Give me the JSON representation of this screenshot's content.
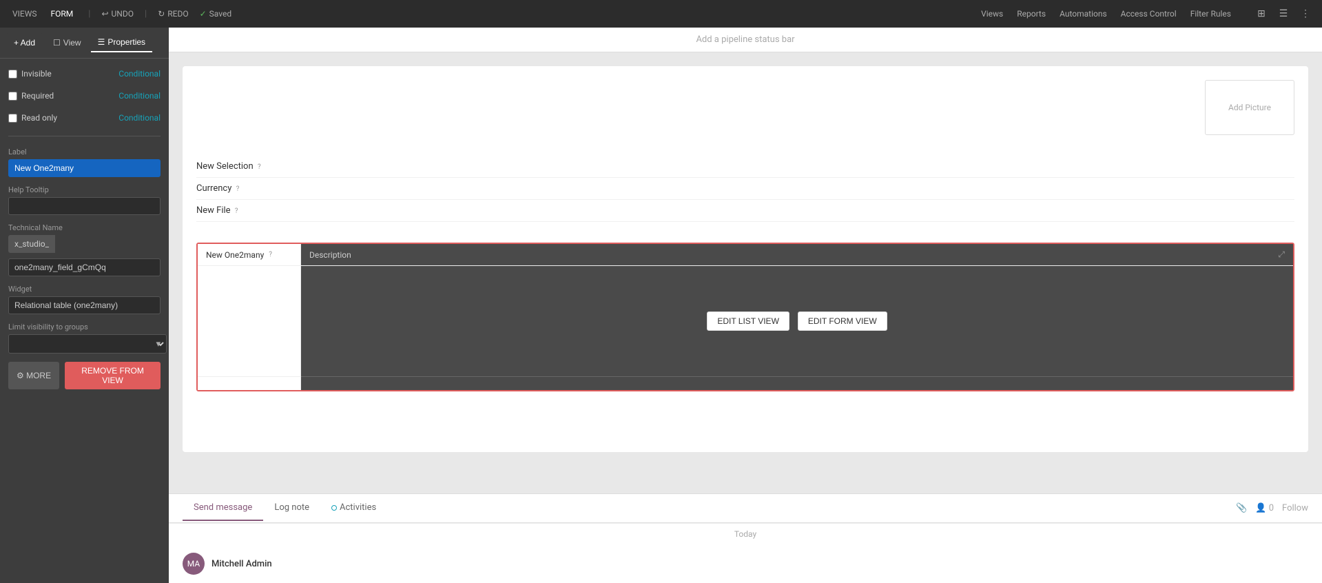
{
  "topnav": {
    "views_label": "VIEWS",
    "form_label": "FORM",
    "undo_label": "UNDO",
    "redo_label": "REDO",
    "saved_label": "Saved",
    "right_links": [
      "Views",
      "Reports",
      "Automations",
      "Access Control",
      "Filter Rules"
    ]
  },
  "sidebar": {
    "add_label": "+ Add",
    "view_label": "View",
    "properties_label": "Properties",
    "conditionals": [
      {
        "id": "invisible",
        "label": "Invisible",
        "tag": "Conditional"
      },
      {
        "id": "required",
        "label": "Required",
        "tag": "Conditional"
      },
      {
        "id": "readonly",
        "label": "Read only",
        "tag": "Conditional"
      }
    ],
    "label_field": "Label",
    "label_value": "New One2many",
    "help_tooltip_label": "Help Tooltip",
    "technical_name_label": "Technical Name",
    "prefix_value": "x_studio_",
    "suffix_value": "one2many_field_gCmQq",
    "widget_label": "Widget",
    "widget_value": "Relational table (one2many)",
    "visibility_label": "Limit visibility to groups",
    "more_label": "⚙ MORE",
    "remove_label": "REMOVE FROM VIEW"
  },
  "form": {
    "pipeline_bar": "Add a pipeline status bar",
    "add_picture_label": "Add Picture",
    "fields": [
      {
        "label": "New Selection",
        "has_tooltip": true
      },
      {
        "label": "Currency",
        "has_tooltip": true
      },
      {
        "label": "New File",
        "has_tooltip": true
      }
    ],
    "one2many": {
      "col1_header": "New One2many",
      "col2_header": "Description",
      "edit_list_view": "EDIT LIST VIEW",
      "edit_form_view": "EDIT FORM VIEW"
    }
  },
  "chatter": {
    "tabs": [
      "Send message",
      "Log note",
      "Activities"
    ],
    "today_label": "Today",
    "user_name": "Mitchell Admin",
    "followers_count": "0",
    "follow_label": "Follow"
  }
}
